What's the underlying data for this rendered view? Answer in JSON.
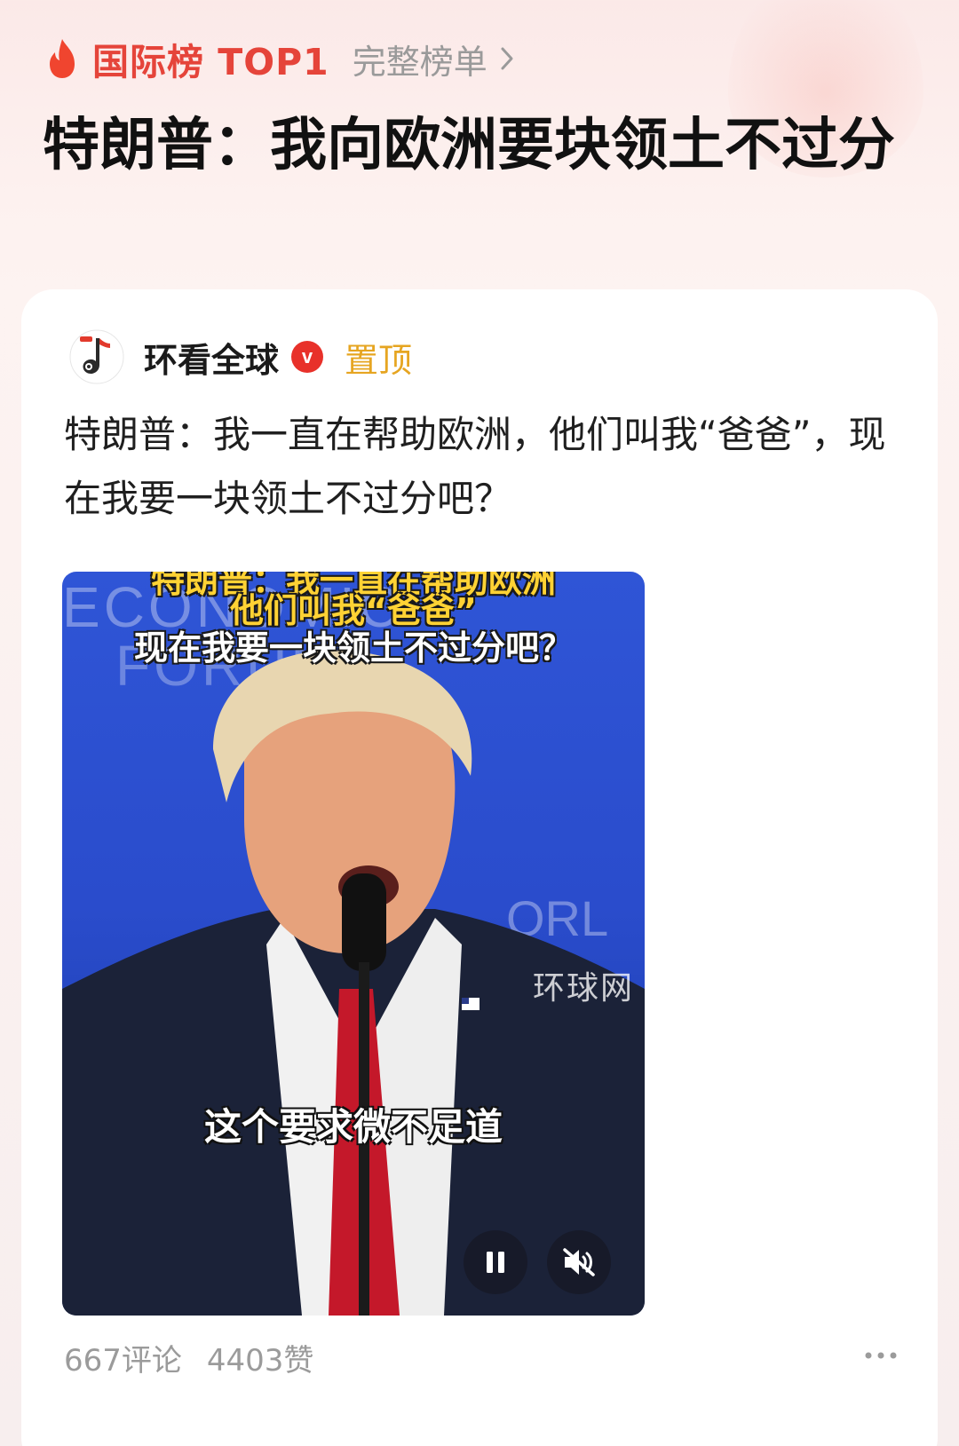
{
  "rank": {
    "label": "国际榜 TOP1",
    "full_list": "完整榜单",
    "accent_color": "#e5443a"
  },
  "headline": "特朗普：我向欧洲要块领土不过分",
  "post": {
    "author": "环看全球",
    "verified_icon": "v",
    "pinned_label": "置顶",
    "text": "特朗普：我一直在帮助欧洲，他们叫我“爸爸”，现在我要一块领土不过分吧？",
    "video": {
      "caption_line_1": "特朗普：我一直在帮助欧洲",
      "caption_line_2": "他们叫我“爸爸”",
      "caption_line_3": "现在我要一块领土不过分吧？",
      "watermark": "环球网",
      "subtitle": "这个要求微不足道",
      "controls": [
        "pause-icon",
        "mute-icon"
      ]
    },
    "comments": "667评论",
    "likes": "4403赞",
    "more_icon": "more-icon"
  }
}
